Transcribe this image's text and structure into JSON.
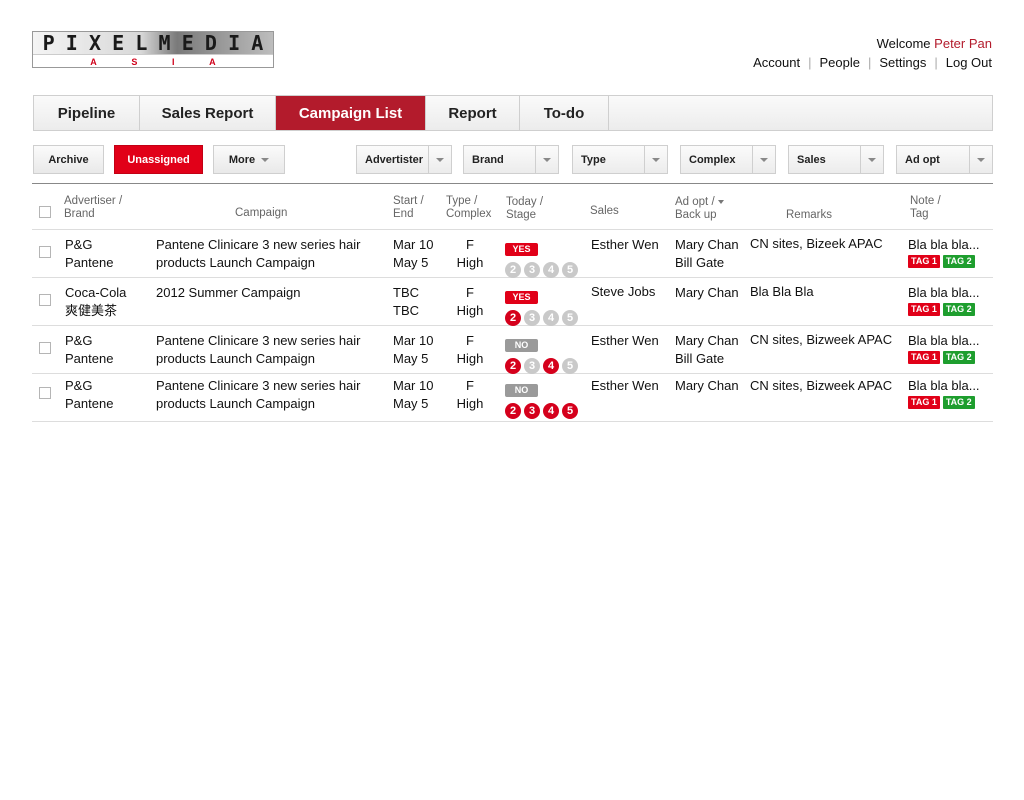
{
  "logo": {
    "top_letters": [
      "P",
      "I",
      "X",
      "E",
      "L",
      "M",
      "E",
      "D",
      "I",
      "A"
    ],
    "bottom_letters": [
      "A",
      "S",
      "I",
      "A"
    ]
  },
  "user": {
    "welcome_prefix": "Welcome",
    "name": "Peter Pan",
    "links": [
      "Account",
      "People",
      "Settings",
      "Log Out"
    ]
  },
  "tabs": [
    {
      "label": "Pipeline",
      "active": false
    },
    {
      "label": "Sales Report",
      "active": false
    },
    {
      "label": "Campaign List",
      "active": true
    },
    {
      "label": "Report",
      "active": false
    },
    {
      "label": "To-do",
      "active": false
    }
  ],
  "toolbar": {
    "archive_label": "Archive",
    "unassigned_label": "Unassigned",
    "more_label": "More",
    "filters": [
      "Advertister",
      "Brand",
      "Type",
      "Complex",
      "Sales",
      "Ad opt"
    ]
  },
  "table": {
    "headers": {
      "advertiser": [
        "Advertiser /",
        "Brand"
      ],
      "campaign": "Campaign",
      "dates": [
        "Start /",
        "End"
      ],
      "type": [
        "Type /",
        "Complex"
      ],
      "today": [
        "Today /",
        "Stage"
      ],
      "sales": "Sales",
      "adopt": [
        "Ad opt /",
        "Back up"
      ],
      "remarks": "Remarks",
      "note": [
        "Note /",
        "Tag"
      ]
    },
    "rows": [
      {
        "advertiser": "P&G",
        "brand": "Pantene",
        "campaign": [
          "Pantene Clinicare 3 new series hair",
          "products Launch Campaign"
        ],
        "start": "Mar 10",
        "end": "May 5",
        "type": "F",
        "complex": "High",
        "today": "YES",
        "stages": [
          2,
          3,
          4,
          5
        ],
        "stages_on": [
          false,
          false,
          false,
          false
        ],
        "sales": "Esther Wen",
        "adopt": "Mary Chan",
        "backup": "Bill Gate",
        "remarks": "CN sites, Bizeek APAC",
        "note": "Bla bla bla...",
        "tags": [
          "TAG 1",
          "TAG 2"
        ]
      },
      {
        "advertiser": "Coca-Cola",
        "brand": "爽健美茶",
        "campaign": [
          "2012 Summer Campaign",
          ""
        ],
        "start": "TBC",
        "end": "TBC",
        "type": "F",
        "complex": "High",
        "today": "YES",
        "stages": [
          2,
          3,
          4,
          5
        ],
        "stages_on": [
          true,
          false,
          false,
          false
        ],
        "sales": "Steve Jobs",
        "adopt": "Mary Chan",
        "backup": "",
        "remarks": "Bla Bla Bla",
        "note": "Bla bla bla...",
        "tags": [
          "TAG 1",
          "TAG 2"
        ]
      },
      {
        "advertiser": "P&G",
        "brand": "Pantene",
        "campaign": [
          "Pantene Clinicare 3 new series hair",
          "products Launch Campaign"
        ],
        "start": "Mar 10",
        "end": "May 5",
        "type": "F",
        "complex": "High",
        "today": "NO",
        "stages": [
          2,
          3,
          4,
          5
        ],
        "stages_on": [
          true,
          false,
          true,
          false
        ],
        "sales": "Esther Wen",
        "adopt": "Mary Chan",
        "backup": "Bill Gate",
        "remarks": "CN sites, Bizweek APAC",
        "note": "Bla bla bla...",
        "tags": [
          "TAG 1",
          "TAG 2"
        ]
      },
      {
        "advertiser": "P&G",
        "brand": "Pantene",
        "campaign": [
          "Pantene Clinicare 3 new series hair",
          "products Launch Campaign"
        ],
        "start": "Mar 10",
        "end": "May 5",
        "type": "F",
        "complex": "High",
        "today": "NO",
        "stages": [
          2,
          3,
          4,
          5
        ],
        "stages_on": [
          true,
          true,
          true,
          true
        ],
        "sales": "Esther Wen",
        "adopt": "Mary Chan",
        "backup": "",
        "remarks": "CN sites, Bizweek APAC",
        "note": "Bla bla bla...",
        "tags": [
          "TAG 1",
          "TAG 2"
        ]
      }
    ]
  }
}
